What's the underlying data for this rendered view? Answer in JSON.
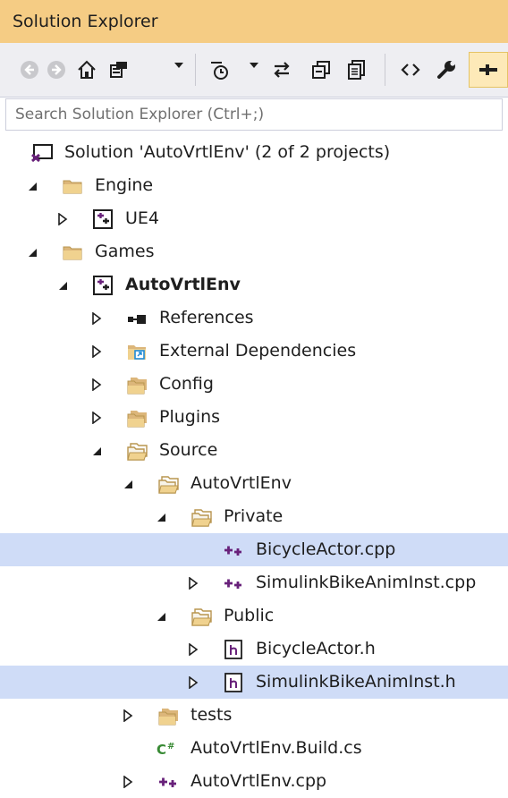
{
  "window": {
    "title": "Solution Explorer"
  },
  "toolbar": {
    "buttons": [
      "back-icon",
      "forward-icon",
      "home-icon",
      "switch-views-icon",
      "pending-changes-filter-icon",
      "sync-icon",
      "collapse-all-icon",
      "show-all-files-icon",
      "code-view-icon",
      "properties-icon",
      "pin-icon"
    ]
  },
  "search": {
    "placeholder": "Search Solution Explorer (Ctrl+;)"
  },
  "tree": {
    "items": [
      {
        "label": "Solution 'AutoVrtlEnv' (2 of 2 projects)",
        "icon": "solution-icon",
        "expander": "none",
        "bold": false,
        "selected": false
      },
      {
        "label": "Engine",
        "icon": "folder-icon",
        "expander": "expanded",
        "bold": false,
        "selected": false
      },
      {
        "label": "UE4",
        "icon": "cpp-project-icon",
        "expander": "collapsed",
        "bold": false,
        "selected": false
      },
      {
        "label": "Games",
        "icon": "folder-icon",
        "expander": "expanded",
        "bold": false,
        "selected": false
      },
      {
        "label": "AutoVrtlEnv",
        "icon": "cpp-project-icon",
        "expander": "expanded",
        "bold": true,
        "selected": false
      },
      {
        "label": "References",
        "icon": "references-icon",
        "expander": "collapsed",
        "bold": false,
        "selected": false
      },
      {
        "label": "External Dependencies",
        "icon": "external-dependencies-icon",
        "expander": "collapsed",
        "bold": false,
        "selected": false
      },
      {
        "label": "Config",
        "icon": "filter-folder-icon",
        "expander": "collapsed",
        "bold": false,
        "selected": false
      },
      {
        "label": "Plugins",
        "icon": "filter-folder-icon",
        "expander": "collapsed",
        "bold": false,
        "selected": false
      },
      {
        "label": "Source",
        "icon": "filter-folder-open-icon",
        "expander": "expanded",
        "bold": false,
        "selected": false
      },
      {
        "label": "AutoVrtlEnv",
        "icon": "filter-folder-open-icon",
        "expander": "expanded",
        "bold": false,
        "selected": false
      },
      {
        "label": "Private",
        "icon": "filter-folder-open-icon",
        "expander": "expanded",
        "bold": false,
        "selected": false
      },
      {
        "label": "BicycleActor.cpp",
        "icon": "cpp-file-icon",
        "expander": "none",
        "bold": false,
        "selected": true
      },
      {
        "label": "SimulinkBikeAnimInst.cpp",
        "icon": "cpp-file-icon",
        "expander": "collapsed",
        "bold": false,
        "selected": false
      },
      {
        "label": "Public",
        "icon": "filter-folder-open-icon",
        "expander": "expanded",
        "bold": false,
        "selected": false
      },
      {
        "label": "BicycleActor.h",
        "icon": "header-file-icon",
        "expander": "collapsed",
        "bold": false,
        "selected": false
      },
      {
        "label": "SimulinkBikeAnimInst.h",
        "icon": "header-file-icon",
        "expander": "collapsed",
        "bold": false,
        "selected": true
      },
      {
        "label": "tests",
        "icon": "filter-folder-icon",
        "expander": "collapsed",
        "bold": false,
        "selected": false
      },
      {
        "label": "AutoVrtlEnv.Build.cs",
        "icon": "csharp-file-icon",
        "expander": "none",
        "bold": false,
        "selected": false
      },
      {
        "label": "AutoVrtlEnv.cpp",
        "icon": "cpp-file-icon",
        "expander": "collapsed",
        "bold": false,
        "selected": false
      }
    ]
  },
  "colors": {
    "title_bar": "#f5cc84",
    "toolbar": "#eeeef2",
    "selection": "#cfdcf7",
    "accent": "#68217a"
  }
}
